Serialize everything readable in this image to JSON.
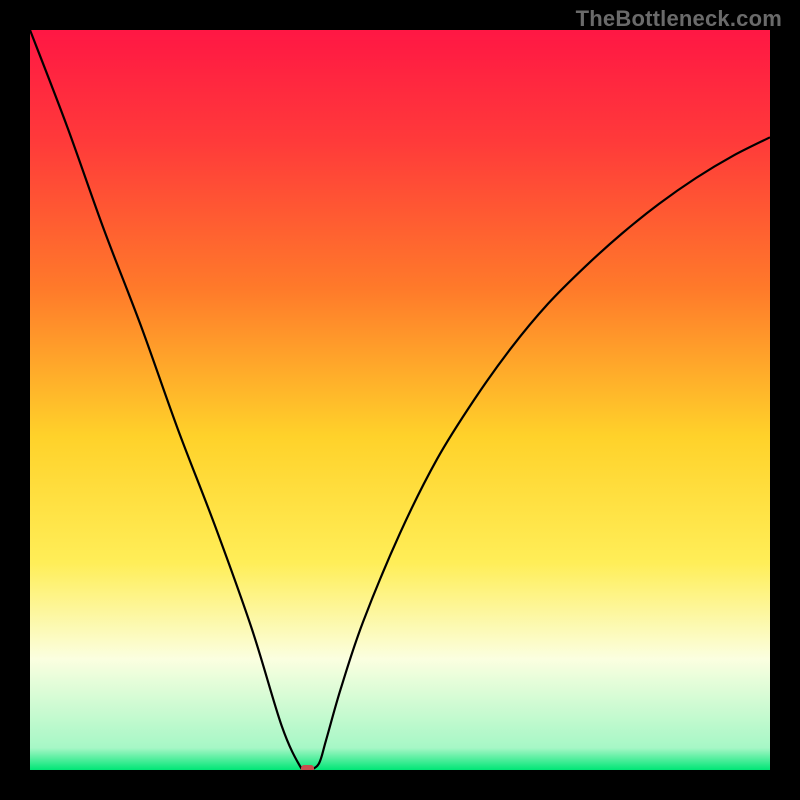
{
  "watermark": "TheBottleneck.com",
  "chart_data": {
    "type": "line",
    "title": "",
    "xlabel": "",
    "ylabel": "",
    "xlim": [
      0,
      100
    ],
    "ylim": [
      0,
      100
    ],
    "background_gradient": [
      {
        "pct": 0,
        "color": "#ff1744"
      },
      {
        "pct": 15,
        "color": "#ff3a3a"
      },
      {
        "pct": 35,
        "color": "#ff7a2a"
      },
      {
        "pct": 55,
        "color": "#ffd22a"
      },
      {
        "pct": 72,
        "color": "#ffee58"
      },
      {
        "pct": 85,
        "color": "#fbffe0"
      },
      {
        "pct": 97,
        "color": "#a6f7c6"
      },
      {
        "pct": 100,
        "color": "#00e676"
      }
    ],
    "series": [
      {
        "name": "bottleneck-curve",
        "color": "#000000",
        "x": [
          0,
          5,
          10,
          15,
          20,
          25,
          30,
          34,
          36.5,
          37.5,
          39,
          40,
          42,
          45,
          50,
          55,
          60,
          65,
          70,
          75,
          80,
          85,
          90,
          95,
          100
        ],
        "y": [
          100,
          87,
          73,
          60,
          46,
          33,
          19,
          6,
          0.5,
          0,
          0.8,
          4,
          11,
          20,
          32,
          42,
          50,
          57,
          63,
          68,
          72.5,
          76.5,
          80,
          83,
          85.5
        ]
      }
    ],
    "marker": {
      "name": "minimum-marker",
      "x": 37.5,
      "y": 0,
      "color": "#c94f4f",
      "shape": "rounded-rect"
    }
  }
}
